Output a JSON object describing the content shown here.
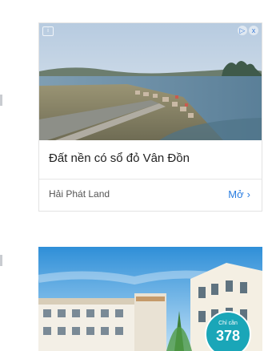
{
  "ads": [
    {
      "headline": "Đất nền có sổ đỏ Vân Đồn",
      "advertiser": "Hải Phát Land",
      "cta_label": "Mở",
      "cta_chevron": "›"
    },
    {
      "badge_small": "Chỉ cần",
      "badge_big": "378"
    }
  ],
  "icons": {
    "adchoices": "i",
    "close": "x",
    "info": "▷"
  }
}
